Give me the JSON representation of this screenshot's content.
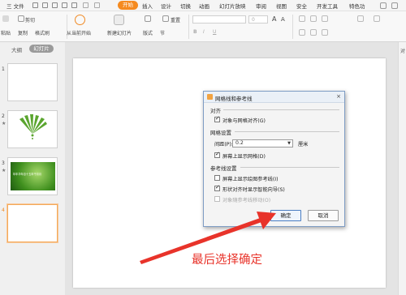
{
  "menubar": {
    "file": "三 文件",
    "start": "开始",
    "tabs": [
      "插入",
      "设计",
      "切换",
      "动画",
      "幻灯片放映",
      "审阅",
      "视图",
      "安全",
      "开发工具",
      "特色功"
    ]
  },
  "ribbon": {
    "cut": "剪切",
    "paste": "粘贴",
    "copy": "复制",
    "format_painter": "格式刷",
    "play_from_current": "从当前开始",
    "new_slide": "新建幻灯片",
    "layout": "版式",
    "section": "节",
    "reset": "重置",
    "font_size": "0",
    "font_size_up": "A",
    "font_size_down": "A"
  },
  "left_panel": {
    "outline_tab": "大纲",
    "slides_tab": "幻灯片",
    "slide_numbers": [
      "1",
      "2",
      "3",
      "4"
    ],
    "slide3_title": "年年华年百十五年千月月"
  },
  "right_strip": {
    "label": "对"
  },
  "dialog": {
    "title": "网格线和参考线",
    "close": "×",
    "align_section": "对齐",
    "snap_to_grid": "对象与网格对齐(G)",
    "grid_section": "网格设置",
    "spacing_label": "间距(P):",
    "spacing_value": "0.2",
    "spacing_unit": "厘米",
    "show_grid": "屏幕上显示网格(D)",
    "guides_section": "参考线设置",
    "show_drawing_guides": "屏幕上显示绘图参考线(I)",
    "show_smart_guides": "形状对齐时显示智能向导(S)",
    "move_with_guides": "对象随参考线移动(O)",
    "ok": "确定",
    "cancel": "取消"
  },
  "annotation": "最后选择确定",
  "colors": {
    "accent": "#f58a1f",
    "annotation": "#e8332a",
    "dialog_border": "#7e9cc4"
  }
}
